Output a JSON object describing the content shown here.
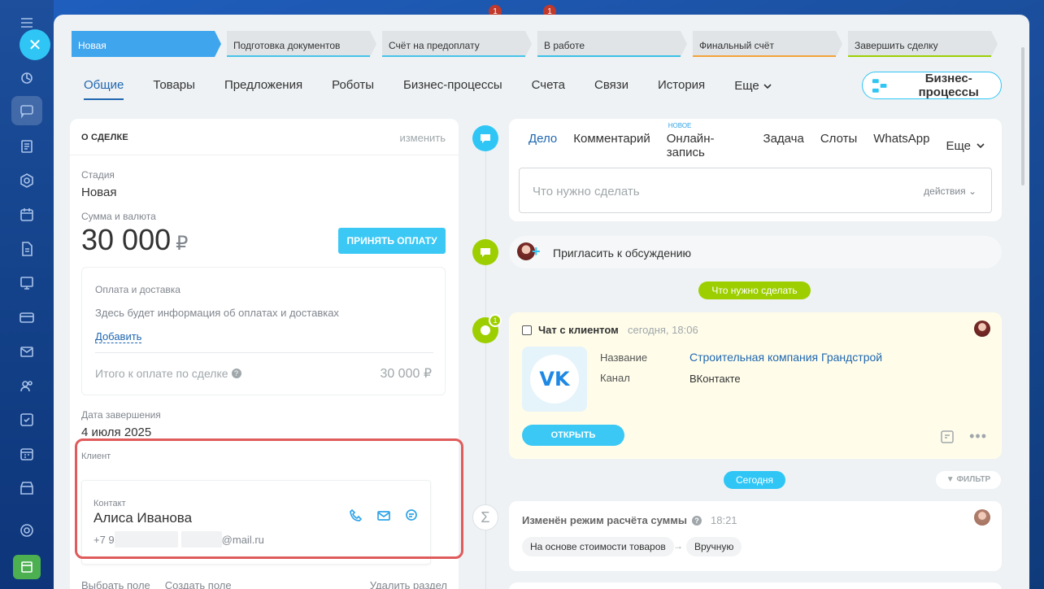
{
  "stages": [
    {
      "label": "Новая",
      "color": "#3fa6ee"
    },
    {
      "label": "Подготовка документов",
      "color": "#47c3e8"
    },
    {
      "label": "Счёт на предоплату",
      "color": "#47c3e8"
    },
    {
      "label": "В работе",
      "color": "#3cc0e6"
    },
    {
      "label": "Финальный счёт",
      "color": "#f2a33a"
    },
    {
      "label": "Завершить сделку",
      "color": "#9dcf00"
    }
  ],
  "top_badges": [
    "1",
    "1"
  ],
  "tabs": [
    "Общие",
    "Товары",
    "Предложения",
    "Роботы",
    "Бизнес-процессы",
    "Счета",
    "Связи",
    "История",
    "Еще"
  ],
  "bp_button": "Бизнес-процессы",
  "deal": {
    "head": "О СДЕЛКЕ",
    "edit": "изменить",
    "stage_label": "Стадия",
    "stage_value": "Новая",
    "sum_label": "Сумма и валюта",
    "sum_value": "30 000",
    "currency": "₽",
    "pay_button": "ПРИНЯТЬ ОПЛАТУ",
    "payment": {
      "title": "Оплата и доставка",
      "info": "Здесь будет информация об оплатах и доставках",
      "add": "Добавить",
      "total_label": "Итого к оплате по сделке",
      "total_value": "30 000 ₽"
    },
    "close_date_label": "Дата завершения",
    "close_date_value": "4 июля 2025",
    "client_label": "Клиент",
    "contact_label": "Контакт",
    "contact_name": "Алиса Иванова",
    "contact_phone_prefix": "+7 9",
    "contact_email_suffix": "@mail.ru",
    "links": [
      "Выбрать поле",
      "Создать поле"
    ],
    "delete_section": "Удалить раздел"
  },
  "activity": {
    "tabs": [
      "Дело",
      "Комментарий",
      "Онлайн-запись",
      "Задача",
      "Слоты",
      "WhatsApp",
      "Еще"
    ],
    "new_badge": "НОВОЕ",
    "placeholder": "Что нужно сделать",
    "actions": "действия"
  },
  "invite_text": "Пригласить к обсуждению",
  "todo_pill": "Что нужно сделать",
  "chat": {
    "badge": "1",
    "title": "Чат с клиентом",
    "time": "сегодня, 18:06",
    "name_label": "Название",
    "name_value": "Строительная компания Грандстрой",
    "channel_label": "Канал",
    "channel_value": "ВКонтакте",
    "open_button": "ОТКРЫТЬ"
  },
  "today_pill": "Сегодня",
  "filter_label": "ФИЛЬТР",
  "history": {
    "title": "Изменён режим расчёта суммы",
    "time": "18:21",
    "from": "На основе стоимости товаров",
    "to": "Вручную"
  }
}
